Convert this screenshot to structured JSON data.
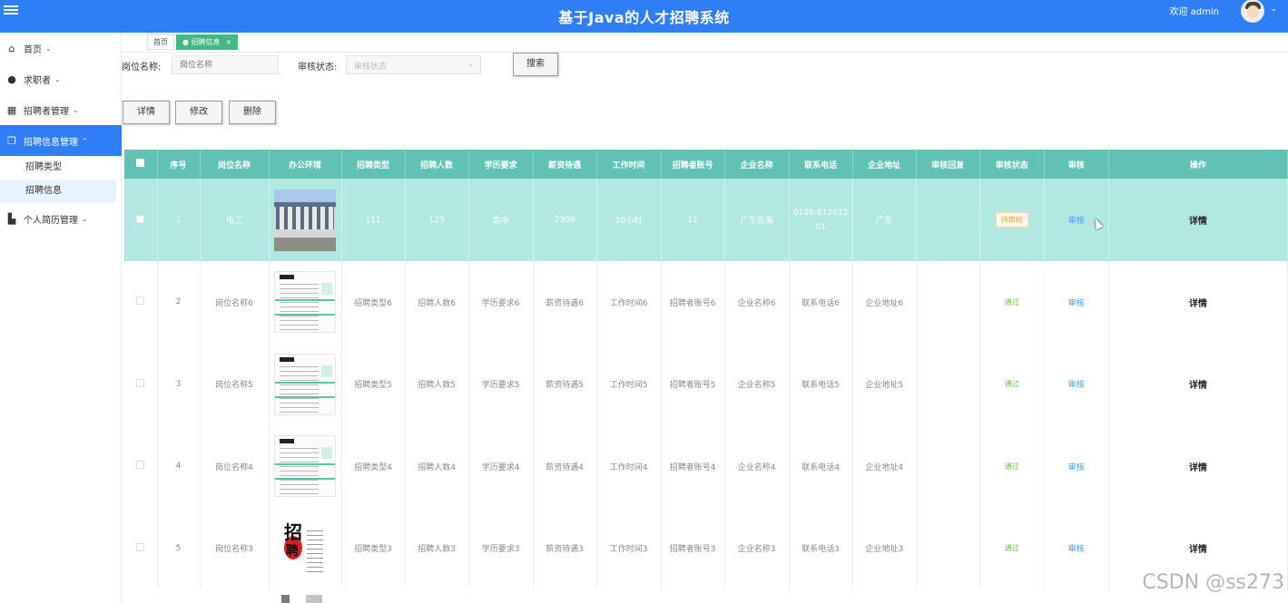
{
  "header": {
    "title": "基于Java的人才招聘系统",
    "welcome": "欢迎 admin"
  },
  "sidebar": {
    "items": [
      {
        "label": "首页"
      },
      {
        "label": "求职者"
      },
      {
        "label": "招聘者管理"
      },
      {
        "label": "招聘信息管理",
        "active": true,
        "children": [
          {
            "label": "招聘类型"
          },
          {
            "label": "招聘信息",
            "active": true
          }
        ]
      },
      {
        "label": "个人简历管理"
      }
    ]
  },
  "tags": [
    {
      "label": "首页"
    },
    {
      "label": "● 招聘信息",
      "active": true
    }
  ],
  "search": {
    "position_label": "岗位名称:",
    "position_placeholder": "岗位名称",
    "status_label": "审核状态:",
    "status_placeholder": "审核状态",
    "search_button": "搜索"
  },
  "actions": {
    "detail": "详情",
    "edit": "修改",
    "delete": "删除"
  },
  "table": {
    "headers": [
      "序号",
      "岗位名称",
      "办公环境",
      "招聘类型",
      "招聘人数",
      "学历要求",
      "薪资待遇",
      "工作时间",
      "招聘者账号",
      "企业名称",
      "联系电话",
      "企业地址",
      "审核回复",
      "审核状态",
      "审核",
      "操作"
    ],
    "rows": [
      {
        "no": "1",
        "name": "电工",
        "image": "office-photo",
        "type": "111",
        "count": "123",
        "edu": "高中",
        "salary": "2300",
        "time": "10小时",
        "account": "11",
        "company": "广东云海",
        "phone": "0120-01201201",
        "address": "广东",
        "reply": "",
        "status": "待审核",
        "audit": "审核",
        "op": "详情"
      },
      {
        "no": "2",
        "name": "岗位名称6",
        "image": "resume-doc",
        "type": "招聘类型6",
        "count": "招聘人数6",
        "edu": "学历要求6",
        "salary": "薪资待遇6",
        "time": "工作时间6",
        "account": "招聘者账号6",
        "company": "企业名称6",
        "phone": "联系电话6",
        "address": "企业地址6",
        "reply": "",
        "status": "通过",
        "audit": "审核",
        "op": "详情"
      },
      {
        "no": "3",
        "name": "岗位名称5",
        "image": "resume-doc",
        "type": "招聘类型5",
        "count": "招聘人数5",
        "edu": "学历要求5",
        "salary": "薪资待遇5",
        "time": "工作时间5",
        "account": "招聘者账号5",
        "company": "企业名称5",
        "phone": "联系电话5",
        "address": "企业地址5",
        "reply": "",
        "status": "通过",
        "audit": "审核",
        "op": "详情"
      },
      {
        "no": "4",
        "name": "岗位名称4",
        "image": "resume-doc",
        "type": "招聘类型4",
        "count": "招聘人数4",
        "edu": "学历要求4",
        "salary": "薪资待遇4",
        "time": "工作时间4",
        "account": "招聘者账号4",
        "company": "企业名称4",
        "phone": "联系电话4",
        "address": "企业地址4",
        "reply": "",
        "status": "通过",
        "audit": "审核",
        "op": "详情"
      },
      {
        "no": "5",
        "name": "岗位名称3",
        "image": "recruit-poster",
        "type": "招聘类型3",
        "count": "招聘人数3",
        "edu": "学历要求3",
        "salary": "薪资待遇3",
        "time": "工作时间3",
        "account": "招聘者账号3",
        "company": "企业名称3",
        "phone": "联系电话3",
        "address": "企业地址3",
        "reply": "",
        "status": "通过",
        "audit": "审核",
        "op": "详情"
      }
    ]
  },
  "watermark": "CSDN @ss273",
  "poster_text": {
    "big": "招",
    "small": "聘"
  },
  "colors": {
    "header": "#2f7ef5",
    "table_header": "#61c1b4",
    "selected_row": "#b2e8e2",
    "pass": "#67c23a",
    "pending": "#e6a23c",
    "audit_link": "#409eff"
  }
}
